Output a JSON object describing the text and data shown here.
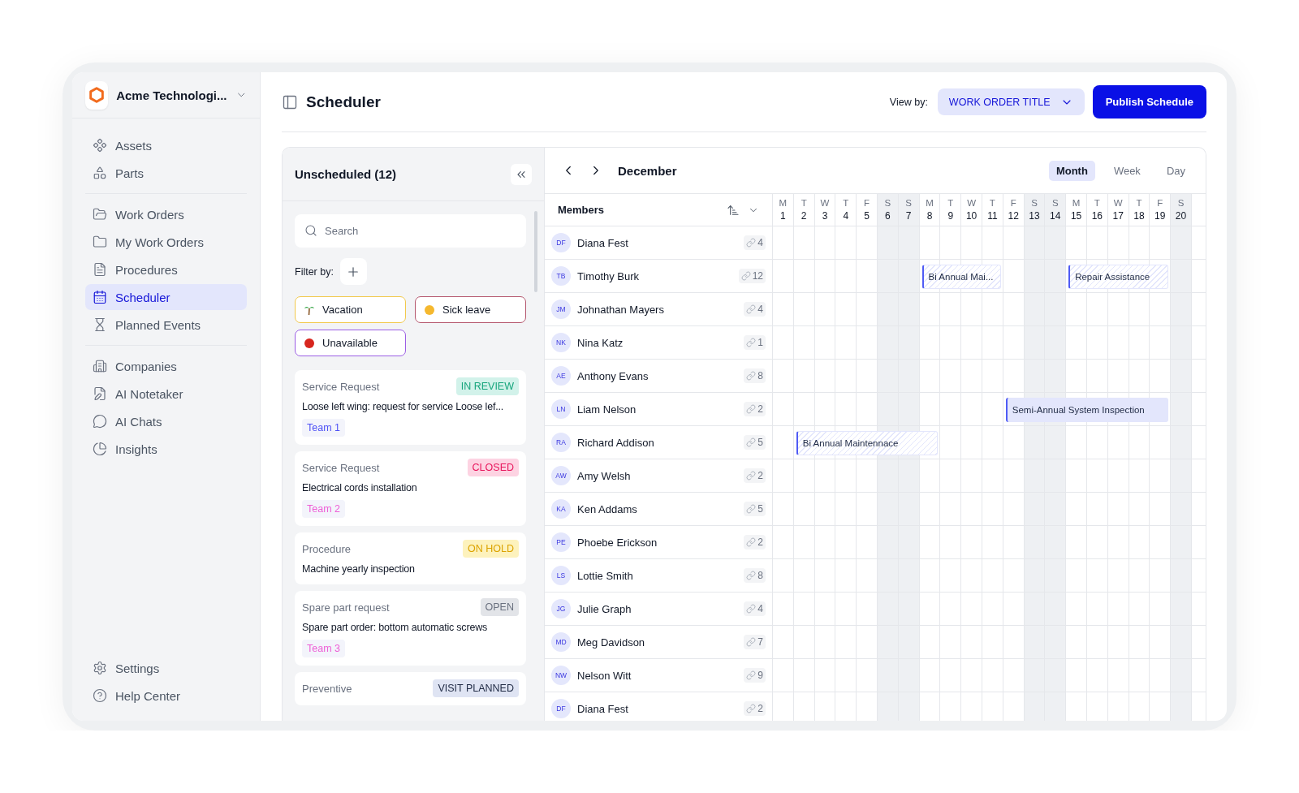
{
  "sidebar": {
    "company": "Acme Technologi...",
    "groups": [
      [
        {
          "label": "Assets",
          "selected": false
        },
        {
          "label": "Parts",
          "selected": false
        }
      ],
      [
        {
          "label": "Work Orders",
          "selected": false
        },
        {
          "label": "My Work Orders",
          "selected": false
        },
        {
          "label": "Procedures",
          "selected": false
        },
        {
          "label": "Scheduler",
          "selected": true
        },
        {
          "label": "Planned Events",
          "selected": false
        }
      ],
      [
        {
          "label": "Companies",
          "selected": false
        },
        {
          "label": "AI Notetaker",
          "selected": false
        },
        {
          "label": "AI Chats",
          "selected": false
        },
        {
          "label": "Insights",
          "selected": false
        }
      ]
    ],
    "bottom": [
      {
        "label": "Settings",
        "selected": false
      },
      {
        "label": "Help Center",
        "selected": false
      }
    ]
  },
  "header": {
    "title": "Scheduler",
    "view_by_label": "View by:",
    "view_by_value": "WORK ORDER TITLE",
    "publish_button": "Publish Schedule"
  },
  "unscheduled": {
    "title": "Unscheduled (12)",
    "search": {
      "placeholder": "Search"
    },
    "filter_label": "Filter by:",
    "legend": [
      {
        "label": "Vacation",
        "color": "#f2c94c"
      },
      {
        "label": "Sick leave",
        "color": "#b5576e"
      },
      {
        "label": "Unavailable",
        "color": "#9b5de5"
      }
    ],
    "cards": [
      {
        "category": "Service Request",
        "status": {
          "label": "IN REVIEW",
          "kind": "review"
        },
        "title": "Loose left wing: request for service Loose lef...",
        "team": {
          "label": "Team 1",
          "color": "#4f52f5"
        }
      },
      {
        "category": "Service Request",
        "status": {
          "label": "CLOSED",
          "kind": "closed"
        },
        "title": "Electrical cords installation",
        "team": {
          "label": "Team 2",
          "color": "#ee5fd6"
        }
      },
      {
        "category": "Procedure",
        "status": {
          "label": "ON HOLD",
          "kind": "hold"
        },
        "title": "Machine yearly inspection"
      },
      {
        "category": "Spare part request",
        "status": {
          "label": "OPEN",
          "kind": "open"
        },
        "title": "Spare part order: bottom automatic screws",
        "team": {
          "label": "Team 3",
          "color": "#ee5fd6"
        }
      },
      {
        "category": "Preventive",
        "status": {
          "label": "VISIT PLANNED",
          "kind": "planned"
        }
      }
    ]
  },
  "calendar": {
    "month": "December",
    "views": [
      {
        "label": "Month",
        "selected": true
      },
      {
        "label": "Week",
        "selected": false
      },
      {
        "label": "Day",
        "selected": false
      }
    ],
    "members_label": "Members",
    "days": [
      {
        "weekday": "M",
        "date": "1",
        "weekend": false
      },
      {
        "weekday": "T",
        "date": "2",
        "weekend": false
      },
      {
        "weekday": "W",
        "date": "3",
        "weekend": false
      },
      {
        "weekday": "T",
        "date": "4",
        "weekend": false
      },
      {
        "weekday": "F",
        "date": "5",
        "weekend": false
      },
      {
        "weekday": "S",
        "date": "6",
        "weekend": true
      },
      {
        "weekday": "S",
        "date": "7",
        "weekend": true
      },
      {
        "weekday": "M",
        "date": "8",
        "weekend": false
      },
      {
        "weekday": "T",
        "date": "9",
        "weekend": false
      },
      {
        "weekday": "W",
        "date": "10",
        "weekend": false
      },
      {
        "weekday": "T",
        "date": "11",
        "weekend": false
      },
      {
        "weekday": "F",
        "date": "12",
        "weekend": false
      },
      {
        "weekday": "S",
        "date": "13",
        "weekend": true
      },
      {
        "weekday": "S",
        "date": "14",
        "weekend": true
      },
      {
        "weekday": "M",
        "date": "15",
        "weekend": false
      },
      {
        "weekday": "T",
        "date": "16",
        "weekend": false
      },
      {
        "weekday": "W",
        "date": "17",
        "weekend": false
      },
      {
        "weekday": "T",
        "date": "18",
        "weekend": false
      },
      {
        "weekday": "F",
        "date": "19",
        "weekend": false
      },
      {
        "weekday": "S",
        "date": "20",
        "weekend": true
      }
    ],
    "members": [
      {
        "initials": "DF",
        "name": "Diana Fest",
        "count": "4"
      },
      {
        "initials": "TB",
        "name": "Timothy Burk",
        "count": "12",
        "timeline": [
          {
            "kind": "free"
          },
          {
            "kind": "free"
          },
          {
            "kind": "free"
          },
          {
            "kind": "free"
          },
          {
            "kind": "free"
          },
          {
            "kind": "free"
          },
          {
            "kind": "free"
          },
          {
            "kind": "planned",
            "title": "Bi Annual Mai..."
          },
          {
            "kind": "more"
          },
          {
            "kind": "more"
          },
          {
            "kind": "more"
          },
          {
            "kind": "free"
          },
          {
            "kind": "free"
          },
          {
            "kind": "free"
          },
          {
            "kind": "planned",
            "title": "Repair Assistance"
          },
          {
            "kind": "more"
          },
          {
            "kind": "more"
          },
          {
            "kind": "more"
          },
          {
            "kind": "more"
          },
          {
            "kind": "free"
          }
        ]
      },
      {
        "initials": "JM",
        "name": "Johnathan Mayers",
        "count": "4"
      },
      {
        "initials": "NK",
        "name": "Nina Katz",
        "count": "1"
      },
      {
        "initials": "AE",
        "name": "Anthony Evans",
        "count": "8"
      },
      {
        "initials": "LN",
        "name": "Liam Nelson",
        "count": "2",
        "timeline": [
          {
            "kind": "free"
          },
          {
            "kind": "free"
          },
          {
            "kind": "free"
          },
          {
            "kind": "free"
          },
          {
            "kind": "free"
          },
          {
            "kind": "free"
          },
          {
            "kind": "free"
          },
          {
            "kind": "free"
          },
          {
            "kind": "free"
          },
          {
            "kind": "free"
          },
          {
            "kind": "free"
          },
          {
            "kind": "booked",
            "title": "Semi-Annual System Inspection"
          },
          {
            "kind": "more"
          },
          {
            "kind": "more"
          },
          {
            "kind": "more"
          },
          {
            "kind": "more"
          },
          {
            "kind": "more"
          },
          {
            "kind": "more"
          },
          {
            "kind": "more"
          },
          {
            "kind": "free"
          }
        ]
      },
      {
        "initials": "RA",
        "name": "Richard Addison",
        "count": "5",
        "timeline": [
          {
            "kind": "free"
          },
          {
            "kind": "planned",
            "title": "Bi Annual Maintennace"
          },
          {
            "kind": "more"
          },
          {
            "kind": "more"
          },
          {
            "kind": "more"
          },
          {
            "kind": "more"
          },
          {
            "kind": "more"
          },
          {
            "kind": "more"
          },
          {
            "kind": "free"
          },
          {
            "kind": "free"
          },
          {
            "kind": "free"
          },
          {
            "kind": "free"
          },
          {
            "kind": "free"
          },
          {
            "kind": "free"
          },
          {
            "kind": "free"
          },
          {
            "kind": "free"
          },
          {
            "kind": "free"
          },
          {
            "kind": "free"
          },
          {
            "kind": "free"
          },
          {
            "kind": "free"
          }
        ]
      },
      {
        "initials": "AW",
        "name": "Amy Welsh",
        "count": "2"
      },
      {
        "initials": "KA",
        "name": "Ken Addams",
        "count": "5"
      },
      {
        "initials": "PE",
        "name": "Phoebe Erickson",
        "count": "2"
      },
      {
        "initials": "LS",
        "name": "Lottie Smith",
        "count": "8"
      },
      {
        "initials": "JG",
        "name": "Julie Graph",
        "count": "4"
      },
      {
        "initials": "MD",
        "name": "Meg Davidson",
        "count": "7"
      },
      {
        "initials": "NW",
        "name": "Nelson Witt",
        "count": "9"
      },
      {
        "initials": "DF",
        "name": "Diana Fest",
        "count": "2"
      }
    ]
  }
}
